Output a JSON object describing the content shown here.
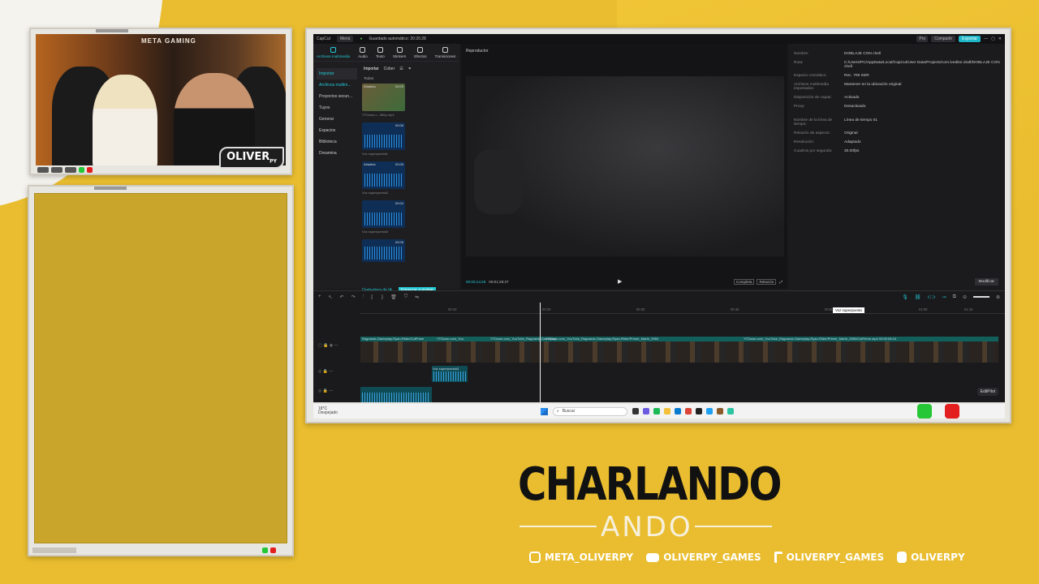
{
  "camera": {
    "top_logo": "META GAMING",
    "badge": "OLIVER",
    "badge_sub": "PY"
  },
  "app": {
    "name": "CapCut",
    "menu_label": "Menú",
    "autosave": "Guardado automático: 20:26:28",
    "pro_label": "Pro",
    "share_label": "Compartir",
    "export_label": "Exportar",
    "tools": [
      "Archivos multimedia",
      "Audio",
      "Texto",
      "Stickers",
      "Efectos",
      "Transiciones"
    ],
    "sidenav": [
      "Importar",
      "Archivos multim...",
      "Proyectos secun...",
      "Tuyos",
      "Generar",
      "Espacios",
      "Biblioteca",
      "Dreamina"
    ],
    "media_bar": {
      "import": "Importar",
      "cobertura": "Cober"
    },
    "todos": "Todos",
    "clips": [
      {
        "tag": "Añadido",
        "dur": "00:09",
        "caption": "YTDown.c...080p.mp4",
        "kind": "video"
      },
      {
        "tag": "",
        "dur": "00:06",
        "caption": "Voz superpuesta1",
        "kind": "audio"
      },
      {
        "tag": "Añadido",
        "dur": "00:05",
        "caption": "Voz superpuesta2",
        "kind": "audio"
      },
      {
        "tag": "",
        "dur": "00:04",
        "caption": "Voz superpuesta3",
        "kind": "audio"
      },
      {
        "tag": "",
        "dur": "00:05",
        "caption": "",
        "kind": "audio"
      }
    ],
    "recorder": "Grabadora de IA",
    "start_record": "Empezar a grabar",
    "player_title": "Reproductor",
    "timecode_current": "00:00:14:28",
    "timecode_total": "00:01:28:27",
    "player_btn1": "Completa",
    "player_btn2": "Relación",
    "properties": [
      {
        "k": "Nombre:",
        "v": "DOBLAJE CON chelí"
      },
      {
        "k": "Ruta:",
        "v": "C:/Users/PC/AppData/Local/CapCut/User Data/Projects/com.lveditor.draft/DOBLAJE CON chelí"
      },
      {
        "k": "Espacio cromático:",
        "v": "Rec. 709 SDR"
      },
      {
        "k": "Archivos multimedia importados:",
        "v": "Mantener en la ubicación original"
      },
      {
        "k": "Disposición de capas:",
        "v": "Activado"
      },
      {
        "k": "Proxy:",
        "v": "Desactivado"
      },
      {
        "k": "Nombre de la línea de tiempo:",
        "v": "Línea de tiempo 01"
      },
      {
        "k": "Relación de aspecto:",
        "v": "Original"
      },
      {
        "k": "Resolución:",
        "v": "Adaptado"
      },
      {
        "k": "Cuadros por segundo:",
        "v": "30.00fps"
      }
    ],
    "modify": "Modificar",
    "tooltip": "Voz superpuesta",
    "ruler": [
      "00:10",
      "00:20",
      "00:30",
      "00:40",
      "00:50",
      "01:00",
      "01:10"
    ],
    "video_track_labels": [
      "Ragnarok-Gameplay-Ryan-Rider/CutPrime",
      "YTDown.com_You",
      "YTDown.com_YouTube_Ragnarok-Gameplay",
      "YTDown.com_YouTube_Ragnarok-Gameplay-Ryan-Rider/Primer_Martir_2960",
      "YTDown.com_YouTube_Ragnarok-Gameplay-Ryan-Rider/Primer_Martir_2960/CutPrime.mp4 00:00:08:15"
    ],
    "audio_track_label": "Voz superpuesta3",
    "editpilot": "EditPilot"
  },
  "taskbar": {
    "weather_temp": "18°C",
    "weather_desc": "Despejado",
    "search_placeholder": "Buscar"
  },
  "brand": {
    "title": "CHARLANDO",
    "subtitle": "ANDO"
  },
  "socials": [
    {
      "icon": "instagram-icon",
      "handle": "META_OLIVERPY"
    },
    {
      "icon": "youtube-icon",
      "handle": "OLIVERPY_GAMES"
    },
    {
      "icon": "tiktok-icon",
      "handle": "OLIVERPY_GAMES"
    },
    {
      "icon": "kick-icon",
      "handle": "OLIVERPY"
    }
  ],
  "colors": {
    "background": "#e9bd2f",
    "accent": "#22c9d6",
    "green_button": "#25c736",
    "red_button": "#e31e1e"
  }
}
